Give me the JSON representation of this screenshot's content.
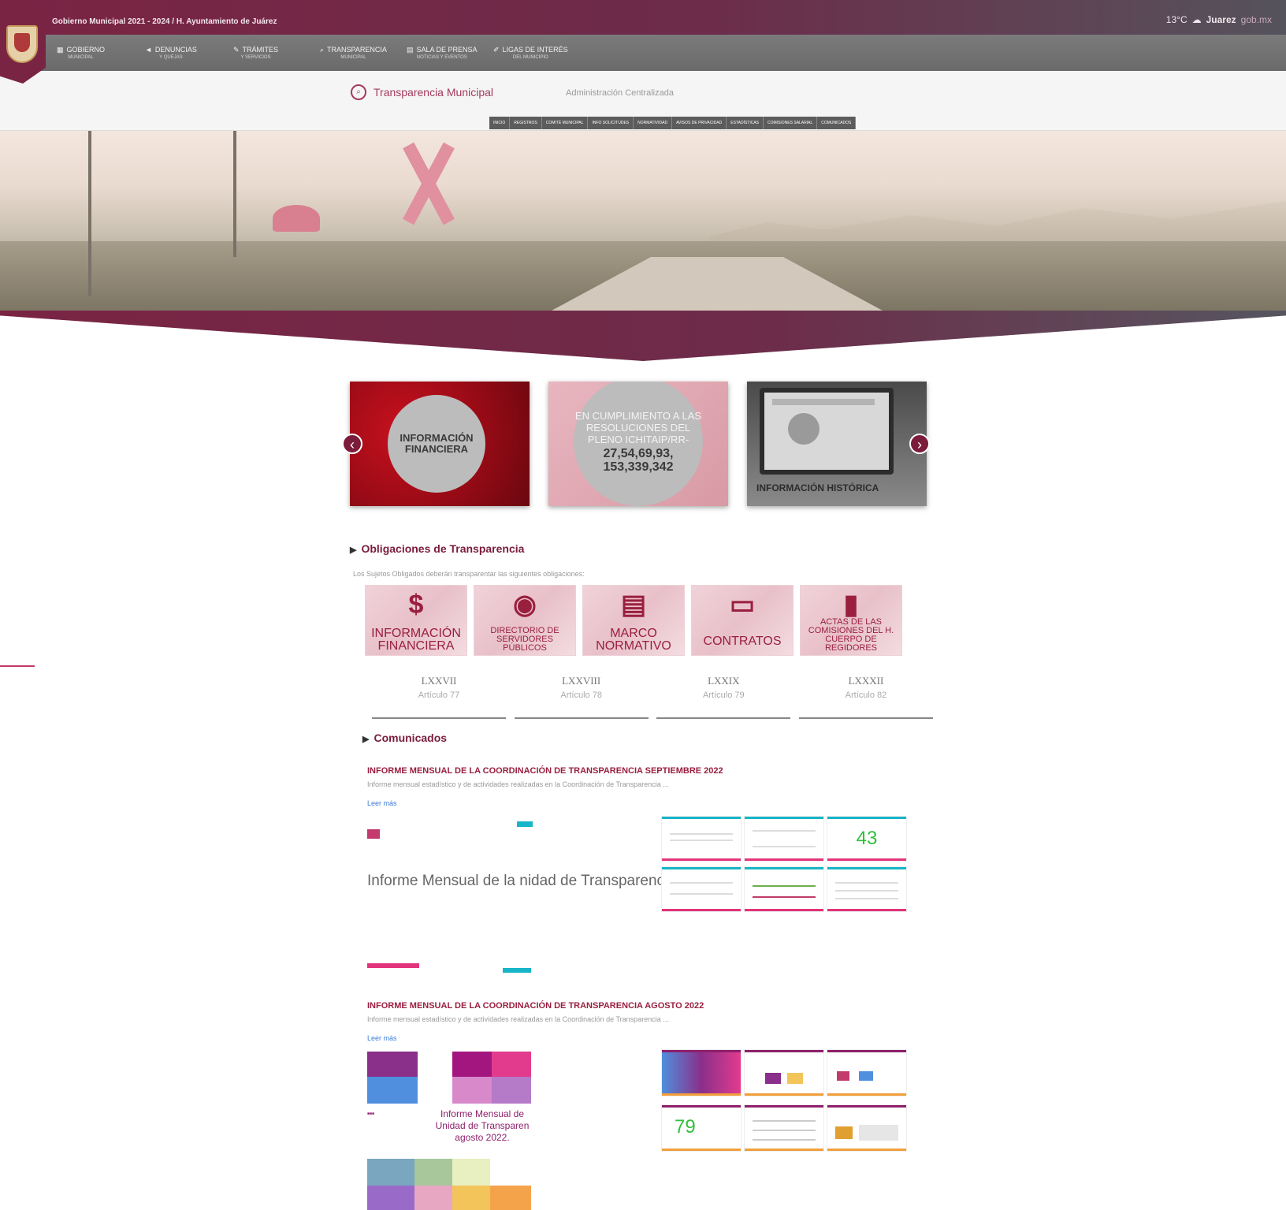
{
  "topbar": {
    "text": "Gobierno Municipal 2021 - 2024 / H. Ayuntamiento de Juárez",
    "temperature": "13°C",
    "brand": "Juarez",
    "brand_suffix": "gob.mx"
  },
  "nav": [
    {
      "icon": "building-icon",
      "label": "GOBIERNO",
      "sub": "MUNICIPAL"
    },
    {
      "icon": "megaphone-icon",
      "label": "DENUNCIAS",
      "sub": "Y QUEJAS"
    },
    {
      "icon": "pencil-icon",
      "label": "TRÁMITES",
      "sub": "Y SERVICIOS"
    },
    {
      "icon": "search-icon",
      "label": "TRANSPARENCIA",
      "sub": "MUNICIPAL"
    },
    {
      "icon": "newspaper-icon",
      "label": "SALA DE PRENSA",
      "sub": "NOTICIAS Y EVENTOS"
    },
    {
      "icon": "link-icon",
      "label": "LIGAS DE INTERÉS",
      "sub": "DEL MUNICIPIO"
    }
  ],
  "subheader": {
    "title": "Transparencia Municipal",
    "admin": "Administración Centralizada",
    "subnav": [
      "INICIO",
      "REGISTROS",
      "COMITÉ MUNICIPAL",
      "INFO SOLICITUDES",
      "NORMATIVIDAD",
      "AVISOS DE PRIVACIDAD",
      "ESTADÍSTICAS",
      "COMISIONES SALARIAL",
      "COMUNICADOS"
    ]
  },
  "carousel": {
    "slide1": "INFORMACIÓN FINANCIERA",
    "slide2_text": "EN CUMPLIMIENTO A LAS RESOLUCIONES DEL PLENO ICHITAIP/RR-",
    "slide2_nums": "27,54,69,93, 153,339,342",
    "slide3": "INFORMACIÓN HISTÓRICA",
    "prev": "‹",
    "next": "›"
  },
  "obligaciones": {
    "title": "Obligaciones de Transparencia",
    "description": "Los Sujetos Obligados deberán transparentar las siguientes obligaciones:",
    "tiles": [
      {
        "icon": "dollar-icon",
        "glyph": "$",
        "label": "INFORMACIÓN FINANCIERA"
      },
      {
        "icon": "directory-icon",
        "glyph": "◉",
        "label": "DIRECTORIO DE SERVIDORES PÚBLICOS"
      },
      {
        "icon": "document-icon",
        "glyph": "▤",
        "label": "MARCO NORMATIVO"
      },
      {
        "icon": "briefcase-icon",
        "glyph": "▭",
        "label": "CONTRATOS"
      },
      {
        "icon": "bookmark-icon",
        "glyph": "▮",
        "label": "ACTAS DE LAS COMISIONES DEL H. CUERPO DE REGIDORES"
      }
    ],
    "articles": [
      {
        "roman": "LXXVII",
        "article": "Artículo 77"
      },
      {
        "roman": "LXXVIII",
        "article": "Artículo 78"
      },
      {
        "roman": "LXXIX",
        "article": "Artículo 79"
      },
      {
        "roman": "LXXXII",
        "article": "Artículo 82"
      }
    ]
  },
  "comunicados": {
    "title": "Comunicados",
    "posts": [
      {
        "title": "INFORME MENSUAL DE LA COORDINACIÓN DE TRANSPARENCIA SEPTIEMBRE 2022",
        "desc": "Informe mensual estadístico y de actividades realizadas en la Coordinación de Transparencia ...",
        "more": "Leer más",
        "cover_title": "Informe Mensual de la nidad de Transparenci",
        "thumb_number": "43"
      },
      {
        "title": "INFORME MENSUAL DE LA COORDINACIÓN DE TRANSPARENCIA AGOSTO 2022",
        "desc": "Informe mensual estadístico y de actividades realizadas en la Coordinación de Transparencia ...",
        "more": "Leer más",
        "cover_title": "Informe Mensual de Unidad de Transparen agosto 2022.",
        "thumb_number": "79"
      }
    ]
  },
  "colors": {
    "brand": "#7a2443",
    "nav_gray": "#6a6a6a",
    "accent_pink": "#e2347a",
    "accent_cyan": "#18b5c8"
  }
}
